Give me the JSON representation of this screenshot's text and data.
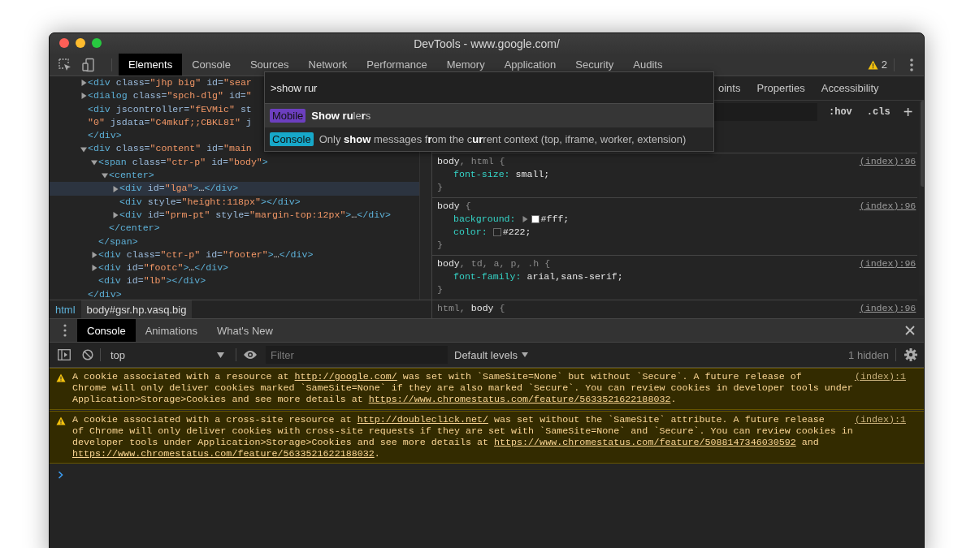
{
  "window": {
    "title": "DevTools - www.google.com/"
  },
  "toolbar": {
    "tabs": [
      {
        "label": "Elements",
        "selected": true
      },
      {
        "label": "Console",
        "selected": false
      },
      {
        "label": "Sources",
        "selected": false
      },
      {
        "label": "Network",
        "selected": false
      },
      {
        "label": "Performance",
        "selected": false
      },
      {
        "label": "Memory",
        "selected": false
      },
      {
        "label": "Application",
        "selected": false
      },
      {
        "label": "Security",
        "selected": false
      },
      {
        "label": "Audits",
        "selected": false
      }
    ],
    "warnings": "2"
  },
  "elements": {
    "nodes": [
      {
        "lines": [
          [
            {
              "kind": "tag",
              "text": "<div"
            },
            {
              "kind": "attr",
              "text": " class="
            },
            {
              "kind": "value",
              "text": "\"jhp big\""
            },
            {
              "kind": "attr",
              "text": " id="
            },
            {
              "kind": "value",
              "text": "\"sear"
            }
          ]
        ],
        "expanded": false,
        "selected": false
      },
      {
        "lines": [
          [
            {
              "kind": "tag",
              "text": "<dialog"
            },
            {
              "kind": "attr",
              "text": " class="
            },
            {
              "kind": "value",
              "text": "\"spch-dlg\""
            },
            {
              "kind": "attr",
              "text": " id="
            },
            {
              "kind": "value",
              "text": "\""
            }
          ]
        ],
        "expanded": false,
        "selected": false
      },
      {
        "lines": [
          [
            {
              "kind": "tag",
              "text": "<div"
            },
            {
              "kind": "attr",
              "text": " jscontroller="
            },
            {
              "kind": "value",
              "text": "\"fEVMic\""
            },
            {
              "kind": "attr",
              "text": " st"
            }
          ],
          [
            {
              "kind": "value",
              "text": "\"0\""
            },
            {
              "kind": "attr",
              "text": " jsdata="
            },
            {
              "kind": "value",
              "text": "\"C4mkuf;;CBKL8I\""
            },
            {
              "kind": "attr",
              "text": " j"
            }
          ]
        ],
        "selected": false,
        "close": [
          {
            "kind": "tag",
            "text": "</div>"
          }
        ]
      },
      {
        "lines": [
          [
            {
              "kind": "tag",
              "text": "<div"
            },
            {
              "kind": "attr",
              "text": " class="
            },
            {
              "kind": "value",
              "text": "\"content\""
            },
            {
              "kind": "attr",
              "text": " id="
            },
            {
              "kind": "value",
              "text": "\"main"
            }
          ]
        ],
        "expanded": true,
        "selected": false,
        "close": [
          {
            "kind": "tag",
            "text": "</div>"
          }
        ],
        "children": [
          {
            "lines": [
              [
                {
                  "kind": "tag",
                  "text": "<span"
                },
                {
                  "kind": "attr",
                  "text": " class="
                },
                {
                  "kind": "value",
                  "text": "\"ctr-p\""
                },
                {
                  "kind": "attr",
                  "text": " id="
                },
                {
                  "kind": "value",
                  "text": "\"body\""
                },
                {
                  "kind": "tag",
                  "text": ">"
                }
              ]
            ],
            "expanded": true,
            "selected": false,
            "close": [
              {
                "kind": "tag",
                "text": "</span>"
              }
            ],
            "children": [
              {
                "lines": [
                  [
                    {
                      "kind": "tag",
                      "text": "<center>"
                    }
                  ]
                ],
                "expanded": true,
                "selected": false,
                "close": [
                  {
                    "kind": "tag",
                    "text": "</center>"
                  }
                ],
                "children": [
                  {
                    "lines": [
                      [
                        {
                          "kind": "tag",
                          "text": "<div"
                        },
                        {
                          "kind": "attr",
                          "text": " id="
                        },
                        {
                          "kind": "value",
                          "text": "\"lga\""
                        },
                        {
                          "kind": "tag",
                          "text": ">"
                        },
                        {
                          "kind": "text",
                          "text": "…"
                        },
                        {
                          "kind": "tag",
                          "text": "</div>"
                        }
                      ]
                    ],
                    "expanded": false,
                    "selected": true
                  },
                  {
                    "lines": [
                      [
                        {
                          "kind": "tag",
                          "text": "<div"
                        },
                        {
                          "kind": "attr",
                          "text": " style="
                        },
                        {
                          "kind": "value",
                          "text": "\"height:118px\""
                        },
                        {
                          "kind": "tag",
                          "text": "></div>"
                        }
                      ]
                    ],
                    "selected": false
                  },
                  {
                    "lines": [
                      [
                        {
                          "kind": "tag",
                          "text": "<div"
                        },
                        {
                          "kind": "attr",
                          "text": " id="
                        },
                        {
                          "kind": "value",
                          "text": "\"prm-pt\""
                        },
                        {
                          "kind": "attr",
                          "text": " style="
                        },
                        {
                          "kind": "value",
                          "text": "\"margin-top:12px\""
                        },
                        {
                          "kind": "tag",
                          "text": ">"
                        },
                        {
                          "kind": "text",
                          "text": "…"
                        },
                        {
                          "kind": "tag",
                          "text": "</div>"
                        }
                      ]
                    ],
                    "expanded": false,
                    "selected": false
                  }
                ]
              }
            ]
          },
          {
            "lines": [
              [
                {
                  "kind": "tag",
                  "text": "<div"
                },
                {
                  "kind": "attr",
                  "text": " class="
                },
                {
                  "kind": "value",
                  "text": "\"ctr-p\""
                },
                {
                  "kind": "attr",
                  "text": " id="
                },
                {
                  "kind": "value",
                  "text": "\"footer\""
                },
                {
                  "kind": "tag",
                  "text": ">"
                },
                {
                  "kind": "text",
                  "text": "…"
                },
                {
                  "kind": "tag",
                  "text": "</div>"
                }
              ]
            ],
            "expanded": false,
            "selected": false
          },
          {
            "lines": [
              [
                {
                  "kind": "tag",
                  "text": "<div"
                },
                {
                  "kind": "attr",
                  "text": " id="
                },
                {
                  "kind": "value",
                  "text": "\"footc\""
                },
                {
                  "kind": "tag",
                  "text": ">"
                },
                {
                  "kind": "text",
                  "text": "…"
                },
                {
                  "kind": "tag",
                  "text": "</div>"
                }
              ]
            ],
            "expanded": false,
            "selected": false
          },
          {
            "lines": [
              [
                {
                  "kind": "tag",
                  "text": "<div"
                },
                {
                  "kind": "attr",
                  "text": " id="
                },
                {
                  "kind": "value",
                  "text": "\"lb\""
                },
                {
                  "kind": "tag",
                  "text": "></div>"
                }
              ]
            ],
            "selected": false
          }
        ]
      }
    ],
    "breadcrumbs": [
      {
        "label": "html",
        "selected": false
      },
      {
        "label": "body#gsr.hp.vasq.big",
        "selected": true
      }
    ]
  },
  "sidebar": {
    "tabs": [
      {
        "label": "oints",
        "selected": false
      },
      {
        "label": "Properties",
        "selected": false
      },
      {
        "label": "Accessibility",
        "selected": false
      }
    ],
    "hov": ":hov",
    "cls": ".cls",
    "add": "+",
    "rules": [
      {
        "selector": [
          {
            "text": "body",
            "matched": true
          },
          {
            "text": ", html",
            "matched": false
          },
          {
            "text": " {",
            "matched": false
          }
        ],
        "source": "(index):96",
        "decls": [
          {
            "prop": "font-size:",
            "value": "small;",
            "expandable": false
          }
        ],
        "close": "}"
      },
      {
        "selector": [
          {
            "text": "body",
            "matched": true
          },
          {
            "text": " {",
            "matched": false
          }
        ],
        "source": "(index):96",
        "decls": [
          {
            "prop": "background:",
            "value": "#fff;",
            "expandable": true,
            "color": "#ffffff"
          },
          {
            "prop": "color:",
            "value": "#222;",
            "expandable": false,
            "color": "#222222"
          }
        ],
        "close": "}"
      },
      {
        "selector": [
          {
            "text": "body",
            "matched": true
          },
          {
            "text": ", td, a, p, .h",
            "matched": false
          },
          {
            "text": " {",
            "matched": false
          }
        ],
        "source": "(index):96",
        "decls": [
          {
            "prop": "font-family:",
            "value": "arial,sans-serif;",
            "expandable": false
          }
        ],
        "close": "}"
      },
      {
        "selector": [
          {
            "text": "html, ",
            "matched": false
          },
          {
            "text": "body",
            "matched": true
          },
          {
            "text": " {",
            "matched": false
          }
        ],
        "source": "(index):96"
      }
    ]
  },
  "palette": {
    "query": ">show rur",
    "items": [
      {
        "category": "Mobile",
        "color": "#6c3fbf",
        "title": "**Show ru**le**r**s",
        "selected": true
      },
      {
        "category": "Console",
        "color": "#17a8c9",
        "title": "Only **show** messages f**r**om the c**ur**rent context (top, iframe, worker, extension)",
        "selected": false
      }
    ]
  },
  "drawer": {
    "tabs": [
      {
        "label": "Console",
        "selected": true
      },
      {
        "label": "Animations",
        "selected": false
      },
      {
        "label": "What's New",
        "selected": false
      }
    ],
    "context": "top",
    "filter": {
      "placeholder": "Filter"
    },
    "levels": "Default levels",
    "hidden": "1 hidden",
    "messages": [
      {
        "source": "(index):1",
        "parts": [
          {
            "text": "A cookie associated with a resource at ",
            "link": false
          },
          {
            "text": "http://google.com/",
            "link": true
          },
          {
            "text": " was set with `SameSite=None` but without `Secure`. A future release of Chrome will only deliver cookies marked `SameSite=None` if they are also marked `Secure`. You can review cookies in developer tools under Application>Storage>Cookies and see more details at ",
            "link": false
          },
          {
            "text": "https://www.chromestatus.com/feature/5633521622188032",
            "link": true
          },
          {
            "text": ".",
            "link": false
          }
        ]
      },
      {
        "source": "(index):1",
        "parts": [
          {
            "text": "A cookie associated with a cross-site resource at ",
            "link": false
          },
          {
            "text": "http://doubleclick.net/",
            "link": true
          },
          {
            "text": " was set without the `SameSite` attribute. A future release of Chrome will only deliver cookies with cross-site requests if they are set with `SameSite=None` and `Secure`. You can review cookies in developer tools under Application>Storage>Cookies and see more details at ",
            "link": false
          },
          {
            "text": "https://www.chromestatus.com/feature/5088147346030592",
            "link": true
          },
          {
            "text": " and ",
            "link": false
          },
          {
            "text": "https://www.chromestatus.com/feature/5633521622188032",
            "link": true
          },
          {
            "text": ".",
            "link": false
          }
        ]
      }
    ]
  }
}
